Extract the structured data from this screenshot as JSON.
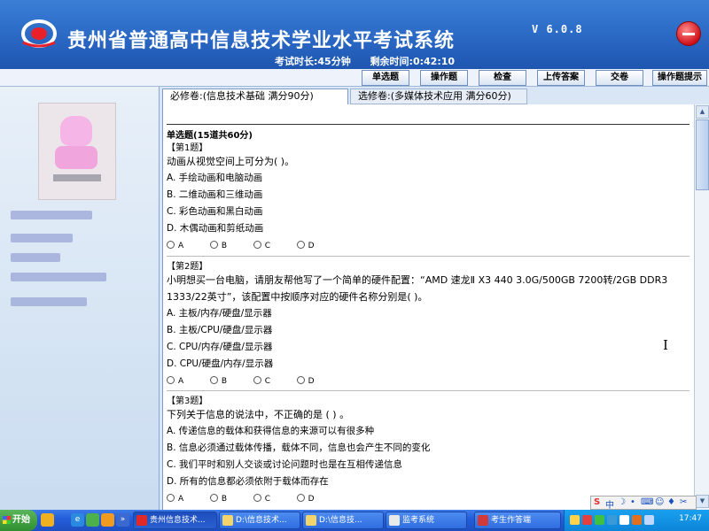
{
  "header": {
    "title": "贵州省普通高中信息技术学业水平考试系统",
    "version": "V 6.0.8",
    "exam_duration": "考试时长:45分钟",
    "remaining_time": "剩余时间:0:42:10"
  },
  "toolbar": {
    "single_choice": "单选题",
    "operation": "操作题",
    "check": "检查",
    "upload": "上传答案",
    "submit": "交卷",
    "hint": "操作题提示"
  },
  "tabs": {
    "required": "必修卷:(信息技术基础 满分90分)",
    "elective": "选修卷:(多媒体技术应用 满分60分)"
  },
  "section_title": "单选题(15道共60分)",
  "questions": [
    {
      "label": "【第1题】",
      "text": "动画从视觉空间上可分为(   )。",
      "options": [
        "A. 手绘动画和电脑动画",
        "B. 二维动画和三维动画",
        "C. 彩色动画和黑白动画",
        "D. 木偶动画和剪纸动画"
      ]
    },
    {
      "label": "【第2题】",
      "text": "小明想买一台电脑，请朋友帮他写了一个简单的硬件配置：“AMD 速龙Ⅱ X3 440 3.0G/500GB 7200转/2GB DDR3 1333/22英寸”，该配置中按顺序对应的硬件名称分别是(      )。",
      "options": [
        "A. 主板/内存/硬盘/显示器",
        "B. 主板/CPU/硬盘/显示器",
        "C. CPU/内存/硬盘/显示器",
        "D. CPU/硬盘/内存/显示器"
      ]
    },
    {
      "label": "【第3题】",
      "text": "下列关于信息的说法中，不正确的是 (   ) 。",
      "options": [
        "A. 传递信息的载体和获得信息的来源可以有很多种",
        "B. 信息必须通过载体传播，载体不同，信息也会产生不同的变化",
        "C. 我们平时和别人交谈或讨论问题时也是在互相传递信息",
        "D. 所有的信息都必须依附于载体而存在"
      ]
    }
  ],
  "radio_labels": [
    "A",
    "B",
    "C",
    "D"
  ],
  "taskbar": {
    "start": "开始",
    "tasks": [
      "贵州信息技术...",
      "D:\\信息技术...",
      "D:\\信息技...",
      "监考系统",
      "考生作答端"
    ],
    "time": "17:47"
  },
  "ime": {
    "lang": "中"
  },
  "colors": {
    "header_bg": "#2a68c4",
    "taskbar_bg": "#245edb",
    "close_red": "#d0101a"
  }
}
